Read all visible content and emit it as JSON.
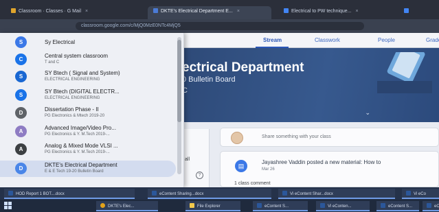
{
  "tabs": [
    {
      "label": "Classroom · Classes · G Mail",
      "active": false
    },
    {
      "label": "DKTE's Electrical Department E...",
      "active": true
    },
    {
      "label": "Electrical to PW technique...",
      "active": false
    },
    {
      "label": "",
      "active": false
    }
  ],
  "address": {
    "url": "classroom.google.com/c/MjQ0MzE0NTc4MjQ5"
  },
  "class_tabs": [
    {
      "label": "Stream",
      "active": true
    },
    {
      "label": "Classwork",
      "active": false
    },
    {
      "label": "People",
      "active": false
    },
    {
      "label": "Grades",
      "active": false
    }
  ],
  "banner": {
    "title": "ectrical Department",
    "subtitle": "0 Bulletin Board",
    "extra": "C",
    "chevron": "⌄"
  },
  "drawer": {
    "items": [
      {
        "name": "Sy Electrical",
        "sub": "",
        "initial": "S",
        "color": "#3b78e7",
        "selected": false
      },
      {
        "name": "Central system classroom",
        "sub": "T and C",
        "initial": "C",
        "color": "#1a73e8",
        "selected": false
      },
      {
        "name": "SY Btech ( Signal and System)",
        "sub": "ELECTRICAL ENGINEERING",
        "initial": "S",
        "color": "#1967d2",
        "selected": false
      },
      {
        "name": "SY Btech (DIGITAL ELECTR...",
        "sub": "ELECTRICAL ENGINEERING",
        "initial": "S",
        "color": "#1a73e8",
        "selected": false
      },
      {
        "name": "Dissertation Phase - II",
        "sub": "PG Electronics & Mtech 2019-20",
        "initial": "D",
        "color": "#5f6368",
        "selected": false
      },
      {
        "name": "Advanced Image/Video Pro...",
        "sub": "PG Electronics & Y. M.Tech 2019-...",
        "initial": "A",
        "color": "#8e7cc3",
        "selected": false
      },
      {
        "name": "Analog & Mixed Mode VLSI ...",
        "sub": "PG Electronics & Y. M.Tech 2019-...",
        "initial": "A",
        "color": "#3c4043",
        "selected": false
      },
      {
        "name": "DKTE's Electrical Department",
        "sub": "E & E Tech 19-20 Bulletin Board",
        "initial": "D",
        "color": "#4a86e8",
        "selected": true
      }
    ]
  },
  "left_snip": "all",
  "share": {
    "placeholder": "Share something with your class"
  },
  "post": {
    "title": "Jayashree Vaddin posted a new material: How to",
    "date": "Mar 26",
    "comment": "1 class comment"
  },
  "taskbar": {
    "row1": [
      {
        "label": "HOD Report 1 BOT....docx",
        "color": "#2b579a"
      },
      {
        "label": "eContent Sharing...docx",
        "color": "#2b579a"
      },
      {
        "label": "Vi eContent Shar...docx",
        "color": "#2b579a"
      },
      {
        "label": "Vi eCo",
        "color": "#2b579a"
      }
    ],
    "row2": [
      {
        "label": "DKTE's Elec...",
        "color": "#e3a21a"
      },
      {
        "label": "File Explorer",
        "color": "#f2c94c"
      },
      {
        "label": "eContent S...",
        "color": "#2b579a"
      },
      {
        "label": "Vi eConten...",
        "color": "#2b579a"
      },
      {
        "label": "eContent S...",
        "color": "#2b579a"
      },
      {
        "label": "eCo",
        "color": "#2b579a"
      }
    ]
  },
  "colors": {
    "accent": "#2b57b7",
    "banner": "#37598e"
  }
}
